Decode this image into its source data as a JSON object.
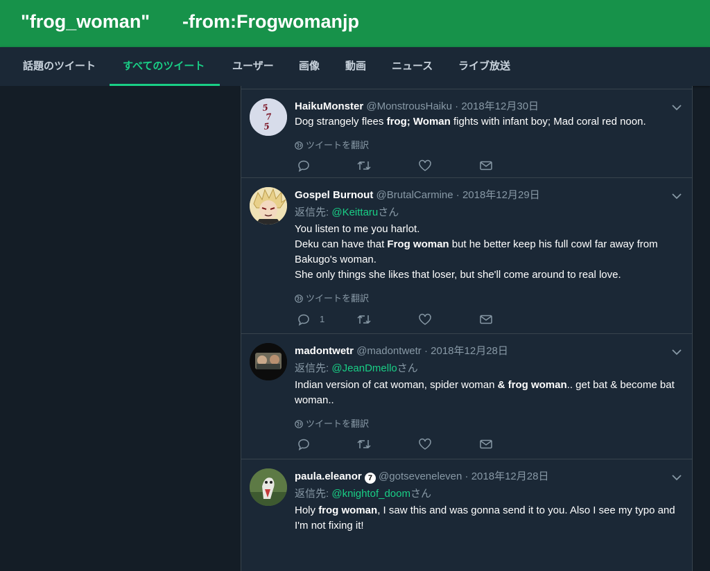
{
  "search": {
    "part1": "\"frog_woman\"",
    "part2": "-from:Frogwomanjp"
  },
  "tabs": [
    {
      "label": "話題のツイート"
    },
    {
      "label": "すべてのツイート"
    },
    {
      "label": "ユーザー"
    },
    {
      "label": "画像"
    },
    {
      "label": "動画"
    },
    {
      "label": "ニュース"
    },
    {
      "label": "ライブ放送"
    }
  ],
  "active_tab": "すべてのツイート",
  "translate_label": "ツイートを翻訳",
  "reply_prefix": "返信先:",
  "reply_suffix": "さん",
  "tweets": [
    {
      "name": "HaikuMonster",
      "handle": "@MonstrousHaiku",
      "date": "2018年12月30日",
      "body": {
        "pre": "Dog strangely flees ",
        "bold": "frog; Woman",
        "post": " fights with infant boy; Mad coral red noon."
      },
      "avatar_text": "575"
    },
    {
      "name": "Gospel Burnout",
      "handle": "@BrutalCarmine",
      "date": "2018年12月29日",
      "reply_to": "@Keittaru",
      "lines": {
        "l1": "You listen to me you harlot.",
        "l2_pre": "Deku can have that ",
        "l2_bold": "Frog woman",
        "l2_post": " but he better keep his full cowl far away from Bakugo's woman.",
        "l3": "She only things she likes that loser, but she'll come around to real love."
      },
      "reply_count": "1"
    },
    {
      "name": "madontwetr",
      "handle": "@madontwetr",
      "date": "2018年12月28日",
      "reply_to": "@JeanDmello",
      "body": {
        "pre": "Indian version of cat woman, spider woman ",
        "bold": "& frog woman",
        "post": ".. get bat & become bat woman.."
      }
    },
    {
      "name": "paula.eleanor",
      "badge": "7",
      "handle": "@gotseveneleven",
      "date": "2018年12月28日",
      "reply_to": "@knightof_doom",
      "body": {
        "pre": "Holy ",
        "bold": "frog woman",
        "post": ", I saw this and was gonna send it to you. Also I see my typo and I'm not fixing it!"
      }
    }
  ],
  "colors": {
    "header": "#17924a",
    "accent": "#19cf86",
    "background": "#141d26",
    "card": "#1b2836"
  }
}
